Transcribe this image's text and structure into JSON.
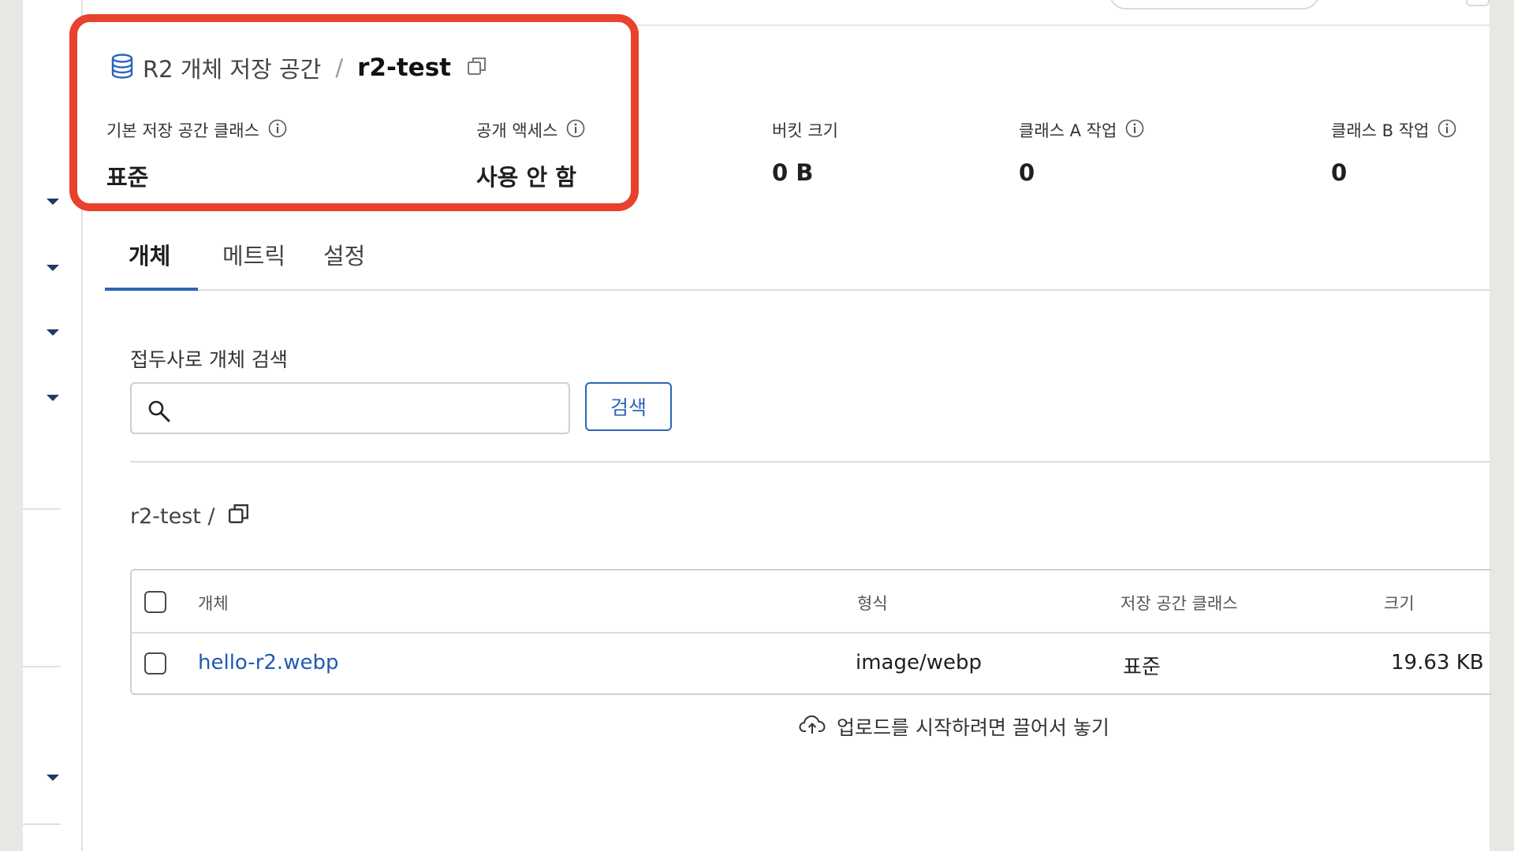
{
  "header": {
    "breadcrumb_root": "R2 개체 저장 공간",
    "breadcrumb_sep": "/",
    "bucket_name": "r2-test"
  },
  "stats": [
    {
      "label": "기본 저장 공간 클래스",
      "value": "표준"
    },
    {
      "label": "공개 액세스",
      "value": "사용 안 함"
    },
    {
      "label": "버킷 크기",
      "value": "0 B"
    },
    {
      "label": "클래스 A 작업",
      "value": "0"
    },
    {
      "label": "클래스 B 작업",
      "value": "0"
    }
  ],
  "tabs": [
    {
      "label": "개체",
      "active": true
    },
    {
      "label": "메트릭",
      "active": false
    },
    {
      "label": "설정",
      "active": false
    }
  ],
  "search": {
    "label": "접두사로 개체 검색",
    "value": "",
    "button": "검색"
  },
  "path": "r2-test /",
  "table": {
    "columns": [
      "개체",
      "형식",
      "저장 공간 클래스",
      "크기"
    ],
    "rows": [
      {
        "name": "hello-r2.webp",
        "type": "image/webp",
        "storage_class": "표준",
        "size": "19.63 KB"
      }
    ]
  },
  "dropzone": "업로드를 시작하려면 끌어서 놓기",
  "colors": {
    "highlight": "#e8412c",
    "accent": "#2c64b8",
    "link": "#2159b5"
  }
}
